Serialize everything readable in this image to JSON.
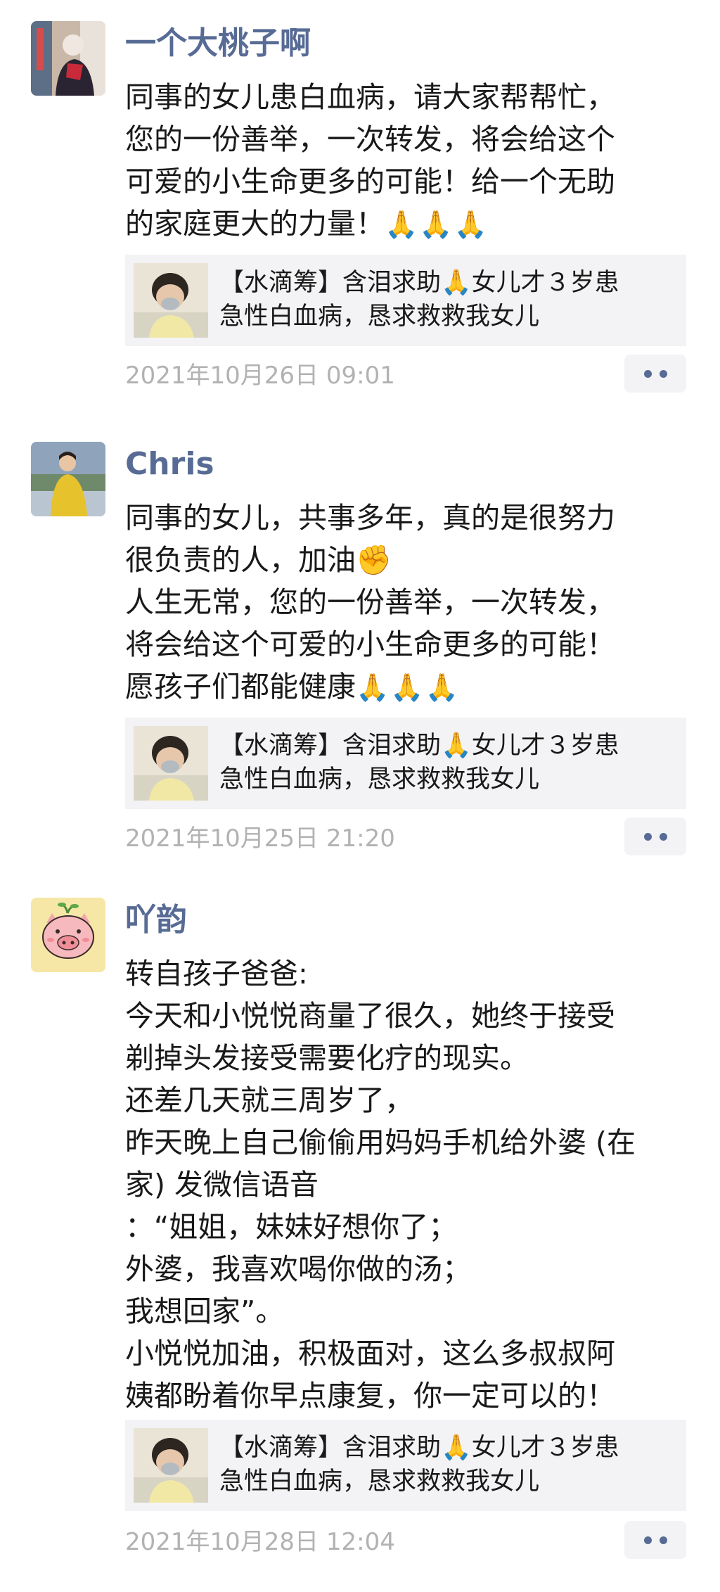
{
  "posts": [
    {
      "author": "一个大桃子啊",
      "avatar_icon": "person-photo-avatar-icon",
      "lines": [
        "同事的女儿患白血病，请大家帮帮忙，",
        "您的一份善举，一次转发，将会给这个",
        "可爱的小生命更多的可能！给一个无助",
        "的家庭更大的力量！"
      ],
      "trailing_emoji": "🙏🙏🙏",
      "share": {
        "title_line1": "【水滴筹】含泪求助🙏女儿才３岁患",
        "title_line2": "急性白血病，恳求救救我女儿",
        "thumb_icon": "child-photo-thumbnail"
      },
      "timestamp": "2021年10月26日 09:01"
    },
    {
      "author": "Chris",
      "avatar_icon": "woman-yellow-sweater-avatar-icon",
      "lines": [
        "同事的女儿，共事多年，真的是很努力",
        "很负责的人，加油✊",
        "人生无常，您的一份善举，一次转发，",
        "将会给这个可爱的小生命更多的可能！",
        "愿孩子们都能健康"
      ],
      "trailing_emoji": "🙏🙏🙏",
      "share": {
        "title_line1": "【水滴筹】含泪求助🙏女儿才３岁患",
        "title_line2": "急性白血病，恳求救救我女儿",
        "thumb_icon": "child-photo-thumbnail"
      },
      "timestamp": "2021年10月25日 21:20"
    },
    {
      "author": "吖韵",
      "avatar_icon": "pig-cartoon-avatar-icon",
      "lines": [
        "转自孩子爸爸:",
        "今天和小悦悦商量了很久，她终于接受",
        "剃掉头发接受需要化疗的现实。",
        "还差几天就三周岁了，",
        "昨天晚上自己偷偷用妈妈手机给外婆 (在",
        "家) 发微信语音",
        "：“姐姐，妹妹好想你了；",
        "外婆，我喜欢喝你做的汤；",
        "我想回家”。",
        " 小悦悦加油，积极面对，这么多叔叔阿",
        "姨都盼着你早点康复，你一定可以的！"
      ],
      "trailing_emoji": "",
      "share": {
        "title_line1": "【水滴筹】含泪求助🙏女儿才３岁患",
        "title_line2": "急性白血病，恳求救救我女儿",
        "thumb_icon": "child-photo-thumbnail"
      },
      "timestamp": "2021年10月28日 12:04"
    }
  ],
  "colors": {
    "name": "#576b95",
    "text": "#191919",
    "timestamp": "#b2b2b2",
    "card_bg": "#f3f3f5"
  }
}
